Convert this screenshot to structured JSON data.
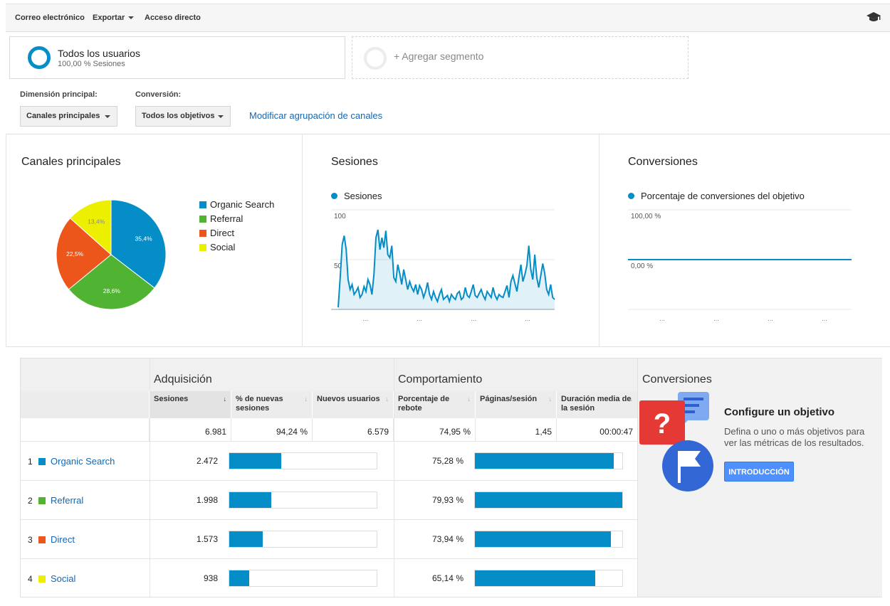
{
  "toolbar": {
    "email": "Correo electrónico",
    "export": "Exportar",
    "shortcut": "Acceso directo",
    "icon": "graduation-cap-icon"
  },
  "segments": {
    "primary_title": "Todos los usuarios",
    "primary_sub": "100,00 % Sesiones",
    "add_label": "+ Agregar segmento"
  },
  "controls": {
    "dimension_label": "Dimensión principal:",
    "dimension_value": "Canales principales",
    "conversion_label": "Conversión:",
    "conversion_value": "Todos los objetivos",
    "modify_link": "Modificar agrupación de canales"
  },
  "panels": {
    "pie_title": "Canales principales",
    "sessions_title": "Sesiones",
    "sessions_series": "Sesiones",
    "conv_title": "Conversiones",
    "conv_series": "Porcentaje de conversiones del objetivo"
  },
  "chart_data": [
    {
      "type": "pie",
      "title": "Canales principales",
      "categories": [
        "Organic Search",
        "Referral",
        "Direct",
        "Social"
      ],
      "values": [
        35.4,
        28.6,
        22.5,
        13.4
      ],
      "labels": [
        "35,4%",
        "28,6%",
        "22,5%",
        "13,4%"
      ],
      "colors": [
        "#058dc7",
        "#50b432",
        "#ed561b",
        "#edef00"
      ],
      "legend": "right"
    },
    {
      "type": "area",
      "title": "Sesiones",
      "series": [
        {
          "name": "Sesiones",
          "values": [
            2,
            32,
            65,
            74,
            60,
            30,
            20,
            25,
            15,
            18,
            22,
            12,
            15,
            23,
            18,
            30,
            25,
            15,
            35,
            72,
            80,
            60,
            72,
            62,
            79,
            55,
            52,
            64,
            32,
            28,
            45,
            36,
            25,
            40,
            30,
            20,
            28,
            22,
            18,
            25,
            15,
            24,
            20,
            12,
            18,
            27,
            15,
            10,
            18,
            12,
            8,
            15,
            20,
            10,
            12,
            14,
            8,
            15,
            12,
            10,
            16,
            18,
            10,
            12,
            22,
            14,
            12,
            18,
            25,
            14,
            12,
            16,
            20,
            14,
            10,
            18,
            15,
            12,
            22,
            14,
            10,
            15,
            13,
            12,
            18,
            24,
            12,
            28,
            34,
            26,
            18,
            32,
            45,
            28,
            35,
            44,
            64,
            40,
            30,
            55,
            32,
            22,
            34,
            46,
            36,
            20,
            15,
            25,
            12,
            10
          ]
        }
      ],
      "yticks": [
        "100",
        "50"
      ],
      "ylim": [
        0,
        100
      ],
      "xticks": [
        "...",
        "...",
        "...",
        "..."
      ],
      "color": "#058dc7"
    },
    {
      "type": "line",
      "title": "Conversiones",
      "series": [
        {
          "name": "Porcentaje de conversiones del objetivo",
          "values": [
            0,
            0
          ]
        }
      ],
      "yticks": [
        "100,00 %",
        "0,00 %"
      ],
      "ylim": [
        0,
        100
      ],
      "xticks": [
        "...",
        "...",
        "...",
        "..."
      ],
      "color": "#058dc7"
    }
  ],
  "table": {
    "group_acq": "Adquisición",
    "group_beh": "Comportamiento",
    "group_conv": "Conversiones",
    "headers": {
      "sessions": "Sesiones",
      "new_sessions": "% de nuevas sesiones",
      "new_users": "Nuevos usuarios",
      "bounce": "Porcentaje de rebote",
      "pages": "Páginas/sesión",
      "duration": "Duración media de la sesión"
    },
    "sort_icon": "sort-desc-icon",
    "totals": {
      "sessions": "6.981",
      "new_sessions": "94,24 %",
      "new_users": "6.579",
      "bounce": "74,95 %",
      "pages": "1,45",
      "duration": "00:00:47"
    },
    "rows": [
      {
        "num": "1",
        "channel": "Organic Search",
        "color": "#058dc7",
        "sessions": "2.472",
        "sessions_share": 35.4,
        "bounce": "75,28 %",
        "bounce_share": 94.2
      },
      {
        "num": "2",
        "channel": "Referral",
        "color": "#50b432",
        "sessions": "1.998",
        "sessions_share": 28.6,
        "bounce": "79,93 %",
        "bounce_share": 100
      },
      {
        "num": "3",
        "channel": "Direct",
        "color": "#ed561b",
        "sessions": "1.573",
        "sessions_share": 22.5,
        "bounce": "73,94 %",
        "bounce_share": 92.5
      },
      {
        "num": "4",
        "channel": "Social",
        "color": "#edef00",
        "sessions": "938",
        "sessions_share": 13.4,
        "bounce": "65,14 %",
        "bounce_share": 81.5
      }
    ]
  },
  "conversions": {
    "title": "Configure un objetivo",
    "desc": "Defina o uno o más objetivos para ver las métricas de los resultados.",
    "button": "INTRODUCCIÓN",
    "illustration": "goal-flag-icon"
  }
}
